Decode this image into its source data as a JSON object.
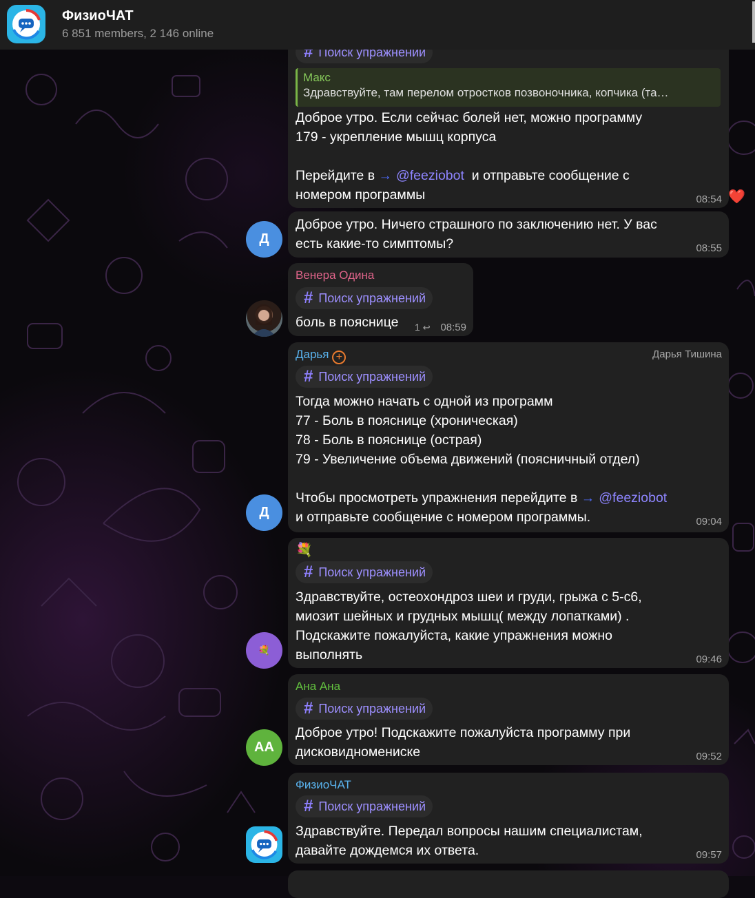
{
  "header": {
    "title": "ФизиоЧАТ",
    "subtitle": "6 851 members, 2 146 online"
  },
  "topic_label": "Поиск упражнений",
  "messages": [
    {
      "reply": {
        "name": "Макс",
        "text": "Здравствуйте, там перелом отростков позвоночника, копчика (та…"
      },
      "text1": "Доброе утро. Если сейчас болей нет, можно программу\n179 - укрепление мышц корпуса",
      "text2_before": "Перейдите в ",
      "link": "@feeziobot",
      "text2_after": "  и отправьте сообщение с",
      "text3": "номером программы",
      "time": "08:54",
      "reaction": "❤️"
    },
    {
      "text": "Доброе утро. Ничего страшного по заключению нет. У вас\nесть какие-то симптомы?",
      "time": "08:55",
      "avatar": "Д"
    },
    {
      "sender": "Венера Одина",
      "text": "боль в пояснице",
      "replies": "1",
      "time": "08:59"
    },
    {
      "sender": "Дарья",
      "role": "Дарья Тишина",
      "text1": "Тогда можно начать с одной из программ\n77 - Боль в пояснице (хроническая)\n78 - Боль в пояснице (острая)\n79 - Увеличение объема движений (поясничный отдел)",
      "text2_before": "Чтобы просмотреть упражнения перейдите в ",
      "link": "@feeziobot",
      "text3": "и отправьте сообщение с номером программы.",
      "time": "09:04",
      "avatar": "Д"
    },
    {
      "sender_emoji": "💐",
      "text": "Здравствуйте, остеохондроз шеи и груди, грыжа с 5-с6,\nмиозит шейных и грудных мышц( между лопатками) .\nПодскажите пожалуйста, какие упражнения можно\nвыполнять",
      "time": "09:46",
      "avatar": "💐"
    },
    {
      "sender": "Ана Ана",
      "text": "Доброе утро! Подскажите пожалуйста программу при\nдисковидномениске",
      "time": "09:52",
      "avatar": "АА"
    },
    {
      "sender": "ФизиоЧАТ",
      "text": "Здравствуйте. Передал вопросы нашим специалистам,\nдавайте дождемся их ответа.",
      "time": "09:57"
    }
  ],
  "colors": {
    "accent": "#9d8fff",
    "bubble": "#212121",
    "avatar_blue": "#4a8fe0",
    "avatar_green": "#5fb33d",
    "avatar_purple": "#8c5ed6"
  }
}
